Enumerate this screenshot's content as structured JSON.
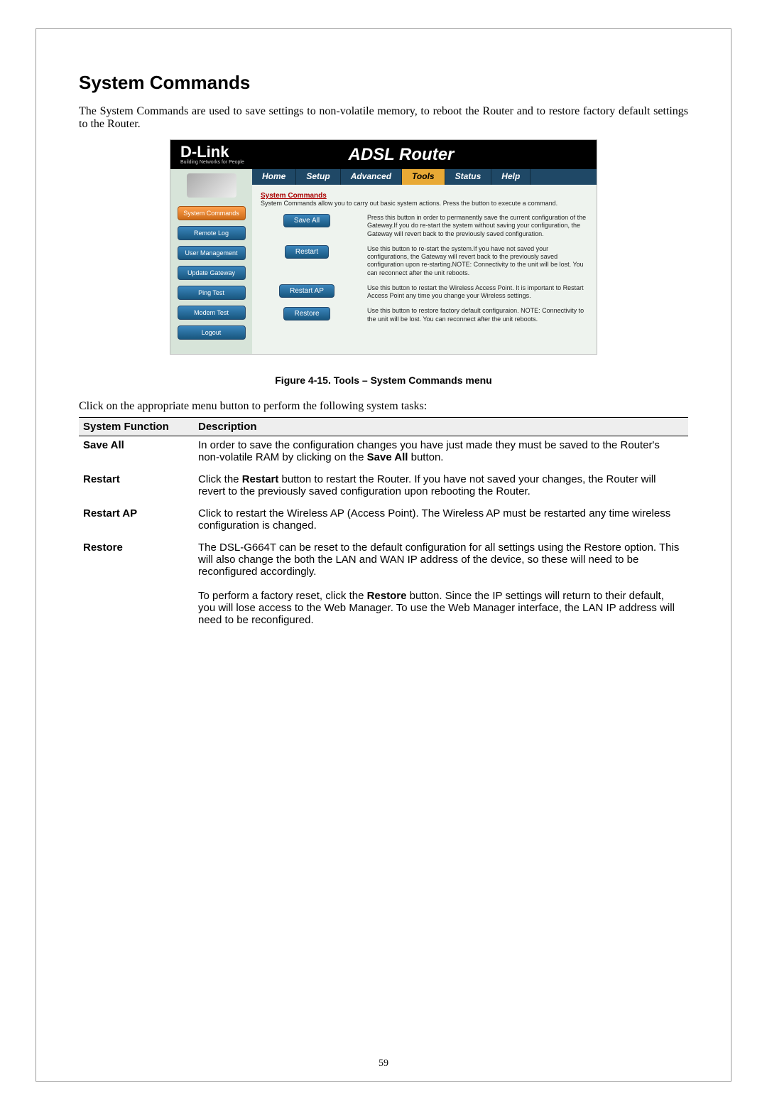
{
  "page": {
    "heading": "System Commands",
    "intro": "The System Commands are used to save settings to non-volatile memory, to reboot the Router and to restore factory default settings to the Router.",
    "figure_caption": "Figure 4-15. Tools – System Commands menu",
    "click_text": "Click on the appropriate menu button to perform the following system tasks:",
    "page_number": "59"
  },
  "router": {
    "brand_big": "D-Link",
    "brand_small": "Building Networks for People",
    "title": "ADSL Router",
    "tabs": [
      "Home",
      "Setup",
      "Advanced",
      "Tools",
      "Status",
      "Help"
    ],
    "active_tab": "Tools",
    "side_items": [
      "System Commands",
      "Remote Log",
      "User Management",
      "Update Gateway",
      "Ping Test",
      "Modem Test",
      "Logout"
    ],
    "active_side": "System Commands",
    "panel_heading": "System Commands",
    "panel_sub": "System Commands allow you to carry out basic system actions. Press the button to execute a command.",
    "commands": [
      {
        "label": "Save All",
        "desc": "Press this button in order to permanently save the current configuration of the Gateway.If you do re-start the system without saving your configuration, the Gateway will revert back to the previously saved configuration."
      },
      {
        "label": "Restart",
        "desc": "Use this button to re-start the system.If you have not saved your configurations, the Gateway will revert back to the previously saved configuration upon re-starting.NOTE: Connectivity to the unit will be lost. You can reconnect after the unit reboots."
      },
      {
        "label": "Restart AP",
        "desc": "Use this button to restart the Wireless Access Point. It is important to Restart Access Point any time you change your Wireless settings."
      },
      {
        "label": "Restore",
        "desc": "Use this button to restore factory default configuraion. NOTE: Connectivity to the unit will be lost. You can reconnect after the unit reboots."
      }
    ]
  },
  "functable": {
    "headers": [
      "System Function",
      "Description"
    ],
    "rows": [
      {
        "func": "Save All",
        "desc_html": "In order to save the configuration changes you have just made they must be saved to the Router's non-volatile RAM by clicking on the <b>Save All</b> button."
      },
      {
        "func": "Restart",
        "desc_html": "Click the <b>Restart</b> button to restart the Router. If you have not saved your changes, the Router will revert to the previously saved configuration upon rebooting the Router."
      },
      {
        "func": "Restart AP",
        "desc_html": "Click to restart the Wireless AP (Access Point). The Wireless AP must be restarted any time wireless configuration is changed."
      },
      {
        "func": "Restore",
        "desc_html": "The DSL-G664T can be reset to the default configuration for all settings using the Restore option. This will also change the both the LAN and WAN IP address of the device, so these will need to be reconfigured accordingly.<br><br>To perform a factory reset, click the <b>Restore</b> button. Since the IP settings will return to their default, you will lose access to the Web Manager. To use the Web Manager interface, the LAN IP address will need to be reconfigured."
      }
    ]
  }
}
